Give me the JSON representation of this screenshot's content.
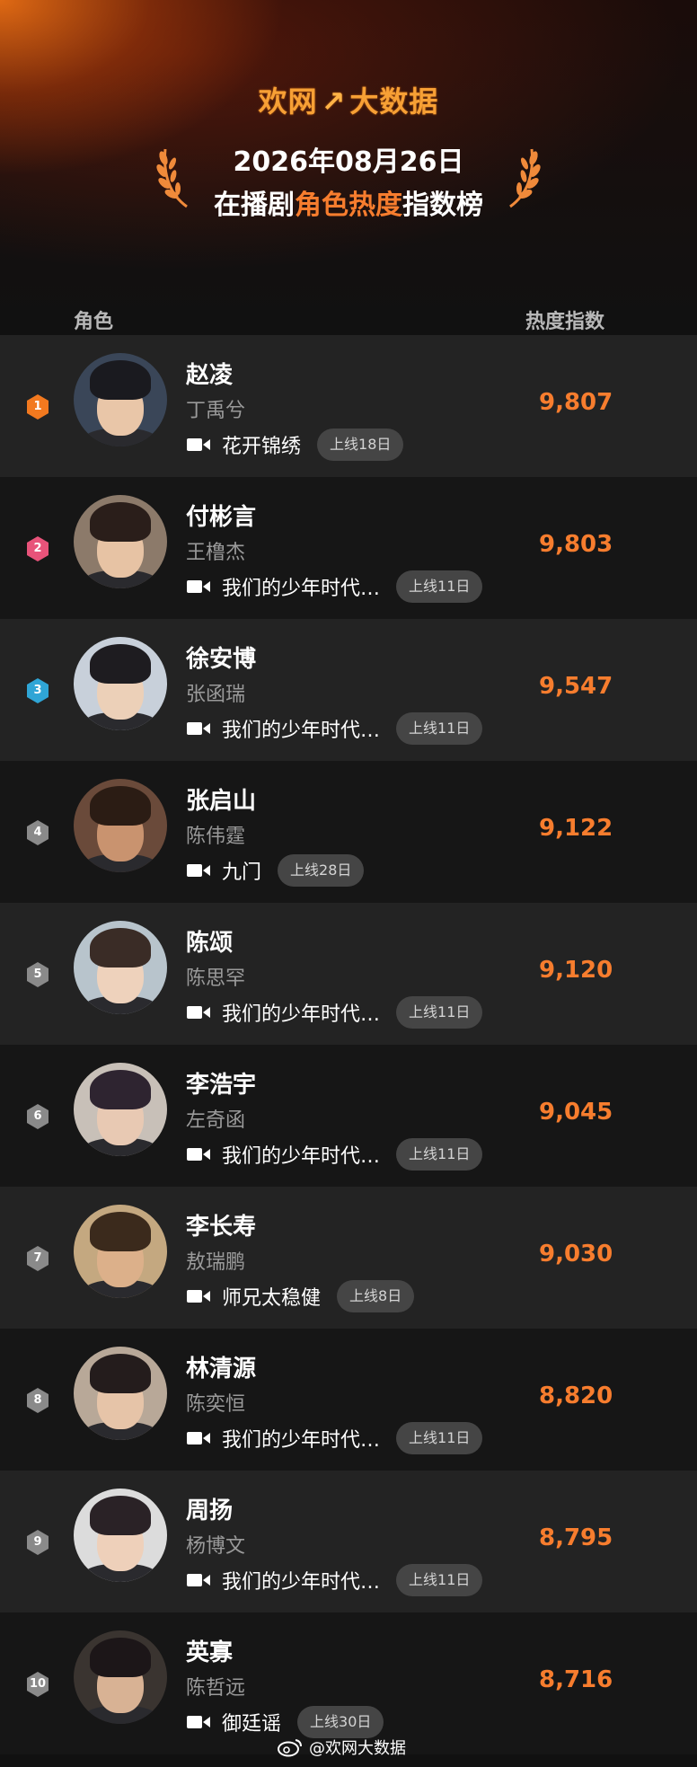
{
  "header": {
    "brand": "欢网",
    "brand_mark": "↗",
    "brand_suffix": "大数据",
    "date": "2026年08月26日",
    "subtitle_pre": "在播剧",
    "subtitle_highlight": "角色热度",
    "subtitle_post": "指数榜"
  },
  "columns": {
    "role": "角色",
    "heat": "热度指数"
  },
  "colors": {
    "accent": "#f77d2e",
    "rank1": "#f2791f",
    "rank2": "#e8537a",
    "rank3": "#2fa5d6",
    "rank_other": "#8a8a8a"
  },
  "rows": [
    {
      "rank": "1",
      "name": "赵凌",
      "actor": "丁禹兮",
      "show": "花开锦绣",
      "days": "上线18日",
      "score": "9,807",
      "icon": "video-icon"
    },
    {
      "rank": "2",
      "name": "付彬言",
      "actor": "王橹杰",
      "show": "我们的少年时代…",
      "days": "上线11日",
      "score": "9,803",
      "icon": "video-icon"
    },
    {
      "rank": "3",
      "name": "徐安博",
      "actor": "张函瑞",
      "show": "我们的少年时代…",
      "days": "上线11日",
      "score": "9,547",
      "icon": "video-icon"
    },
    {
      "rank": "4",
      "name": "张启山",
      "actor": "陈伟霆",
      "show": "九门",
      "days": "上线28日",
      "score": "9,122",
      "icon": "video-icon"
    },
    {
      "rank": "5",
      "name": "陈颂",
      "actor": "陈思罕",
      "show": "我们的少年时代…",
      "days": "上线11日",
      "score": "9,120",
      "icon": "video-icon"
    },
    {
      "rank": "6",
      "name": "李浩宇",
      "actor": "左奇函",
      "show": "我们的少年时代…",
      "days": "上线11日",
      "score": "9,045",
      "icon": "video-icon"
    },
    {
      "rank": "7",
      "name": "李长寿",
      "actor": "敖瑞鹏",
      "show": "师兄太稳健",
      "days": "上线8日",
      "score": "9,030",
      "icon": "video-icon"
    },
    {
      "rank": "8",
      "name": "林清源",
      "actor": "陈奕恒",
      "show": "我们的少年时代…",
      "days": "上线11日",
      "score": "8,820",
      "icon": "video-icon"
    },
    {
      "rank": "9",
      "name": "周扬",
      "actor": "杨博文",
      "show": "我们的少年时代…",
      "days": "上线11日",
      "score": "8,795",
      "icon": "video-icon"
    },
    {
      "rank": "10",
      "name": "英寡",
      "actor": "陈哲远",
      "show": "御廷谣",
      "days": "上线30日",
      "score": "8,716",
      "icon": "video-icon"
    }
  ],
  "watermark": "@欢网大数据"
}
